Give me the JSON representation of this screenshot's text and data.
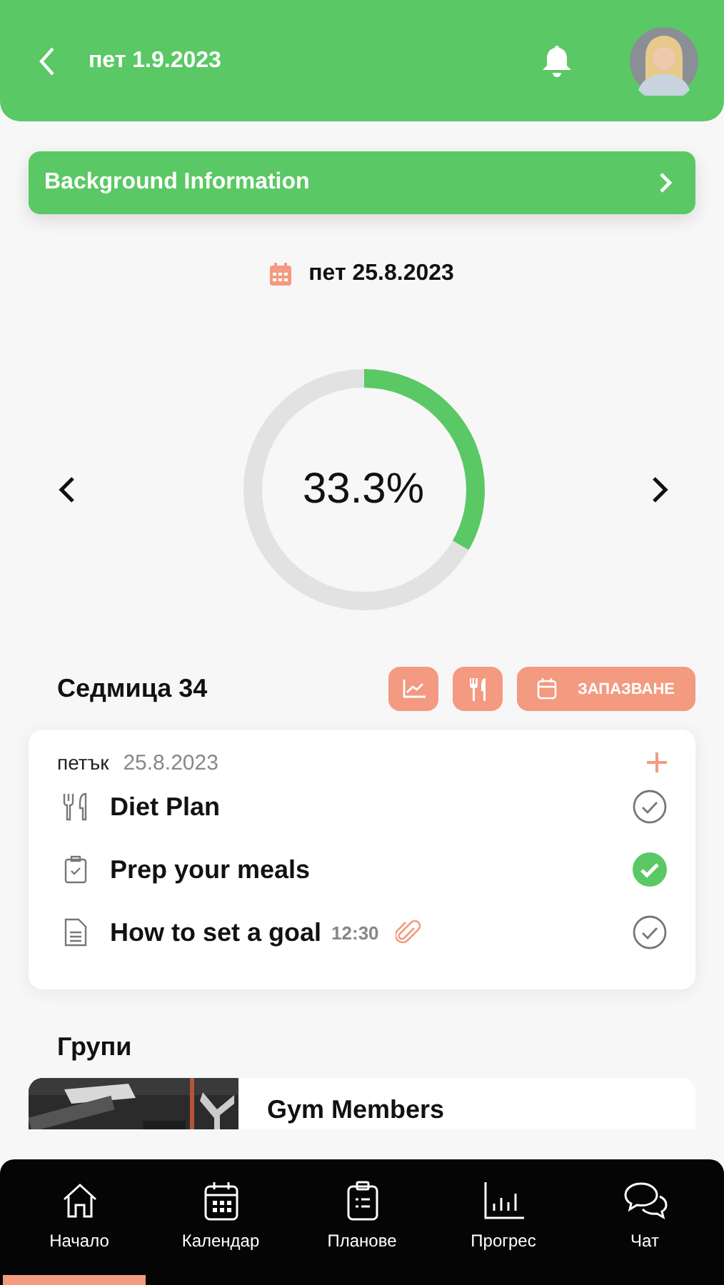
{
  "header": {
    "title": "пет 1.9.2023"
  },
  "info_bar": {
    "label": "Background Information"
  },
  "current_date": "пет 25.8.2023",
  "progress": {
    "reading": "33.3%",
    "level": 0.333
  },
  "week": {
    "title": "Седмица 34",
    "booking_label": "ЗАПАЗВАНЕ"
  },
  "day": {
    "weekday": "петък",
    "date": "25.8.2023",
    "tasks": [
      {
        "kind": "diet",
        "title": "Diet Plan",
        "done": false
      },
      {
        "kind": "checklist",
        "title": "Prep your meals",
        "done": true
      },
      {
        "kind": "document",
        "title": "How to set a goal",
        "time": "12:30",
        "attachment": true,
        "done": false
      }
    ]
  },
  "groups": {
    "title": "Групи",
    "items": [
      {
        "name": "Gym Members",
        "kind": "picture"
      }
    ]
  },
  "nav": [
    {
      "kind": "home",
      "label": "Начало",
      "selected": true
    },
    {
      "kind": "calendar",
      "label": "Календар",
      "selected": false
    },
    {
      "kind": "plans",
      "label": "Планове",
      "selected": false
    },
    {
      "kind": "progress",
      "label": "Прогрес",
      "selected": false
    },
    {
      "kind": "chat",
      "label": "Чат",
      "selected": false
    }
  ]
}
